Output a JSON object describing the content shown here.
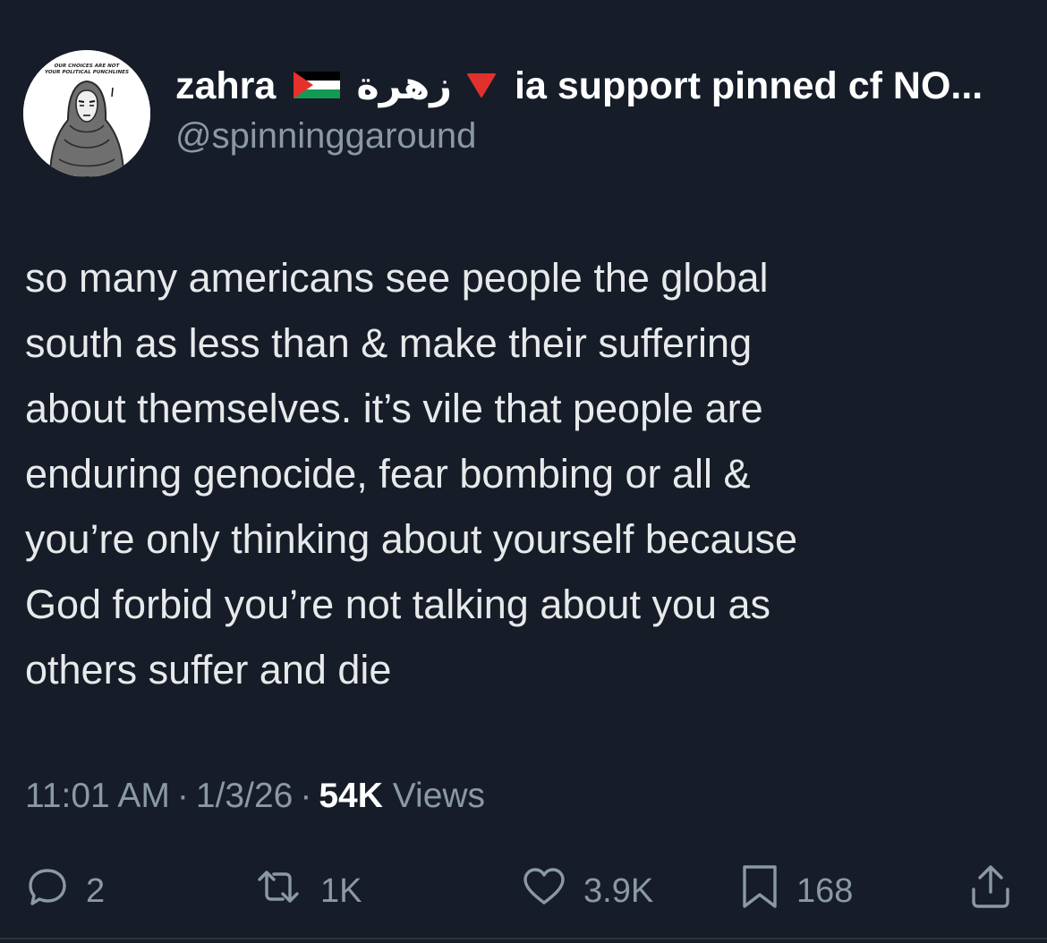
{
  "author": {
    "name": "zahra",
    "arabic_name": "زهرة",
    "name_suffix": "ia support pinned cf NO...",
    "handle": "@spinninggaround",
    "avatar_caption_line1": "OUR CHOICES ARE NOT",
    "avatar_caption_line2": "YOUR POLITICAL PUNCHLINES",
    "flag_colors": {
      "black": "#000000",
      "white": "#ffffff",
      "green": "#149954",
      "red": "#e4312b"
    },
    "emoji_red_triangle_color": "#e0312e"
  },
  "tweet": {
    "lines": [
      "so many americans see people the global",
      "south as less than & make their suffering",
      "about themselves. it’s vile that people are",
      "enduring genocide, fear bombing or all &",
      "you’re only thinking about yourself because",
      "God forbid you’re not talking about you as",
      "others suffer and die"
    ]
  },
  "meta": {
    "time": "11:01 AM",
    "separator": "·",
    "date": "1/3/26",
    "views_count": "54K",
    "views_label": "Views"
  },
  "actions": {
    "replies": "2",
    "reposts": "1K",
    "likes": "3.9K",
    "bookmarks": "168"
  },
  "colors": {
    "background": "#161d28",
    "primary_text": "#e7e9ea",
    "secondary_text": "#8b98a5"
  }
}
